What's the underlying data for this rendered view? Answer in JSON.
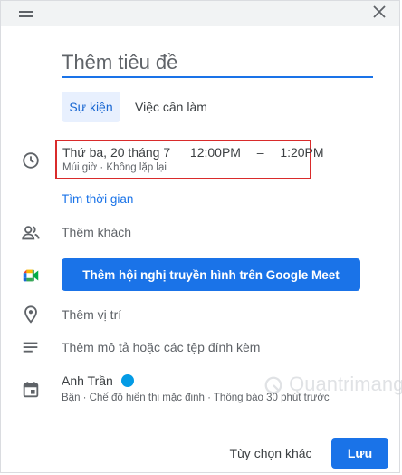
{
  "header": {
    "drag_icon": "drag-handle-icon",
    "close_icon": "close-icon"
  },
  "title": {
    "placeholder": "Thêm tiêu đề",
    "value": ""
  },
  "tabs": [
    {
      "label": "Sự kiện",
      "active": true
    },
    {
      "label": "Việc cần làm",
      "active": false
    }
  ],
  "datetime": {
    "date": "Thứ ba, 20 tháng 7",
    "start": "12:00PM",
    "separator": "–",
    "end": "1:20PM",
    "details": "Múi giờ · Không lặp lại"
  },
  "find_time": "Tìm thời gian",
  "guests": "Thêm khách",
  "meet_button": "Thêm hội nghị truyền hình trên Google Meet",
  "location": "Thêm vị trí",
  "description": "Thêm mô tả hoặc các tệp đính kèm",
  "calendar": {
    "owner": "Anh Trần",
    "owner_color": "#039be5",
    "details": "Bận · Chế độ hiển thị mặc định · Thông báo 30 phút trước"
  },
  "watermark": "Quantrimang",
  "footer": {
    "more_options": "Tùy chọn khác",
    "save": "Lưu"
  },
  "colors": {
    "accent": "#1a73e8",
    "highlight_box": "#d92b2b"
  }
}
